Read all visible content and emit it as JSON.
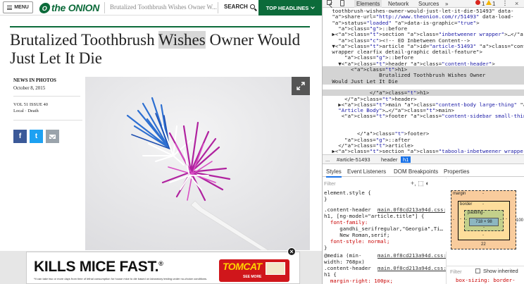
{
  "site": {
    "menu_label": "MENU",
    "logo_mark": "O",
    "logo_text": "the ONION",
    "tab_title": "Brutalized Toothbrush Wishes Owner W...",
    "search_label": "SEARCH",
    "headlines_label": "TOP HEADLINES",
    "headline_before": "Brutalized Toothbrush ",
    "headline_highlight": "Wishes",
    "headline_after": " Owner Would Just Let It Die",
    "kicker": "NEWS IN PHOTOS",
    "date": "October 8, 2015",
    "issue": "VOL 51 ISSUE 40",
    "section": "Local · Death",
    "share_facebook": "f",
    "share_twitter": "t",
    "photo_alt": "toothbrush photo",
    "ad": {
      "headline": "KILLS MICE FAST.",
      "trademark": "®",
      "fine_print": "*It can take two or more days from time of lethal consumption for house mice to die based on laboratory testing under no-choice conditions.",
      "brand": "TOMCAT",
      "cta": "SEE MORE",
      "close": "×"
    }
  },
  "devtools": {
    "tabs": [
      "Elements",
      "Network",
      "Sources",
      "»"
    ],
    "errors": "1",
    "warnings": "1",
    "close": "×",
    "dom_lines": [
      "   toothbrush-wishes-owner-would-just-let-it-die-51493\" data-",
      "   share-url=\"http://www.theonion.com/r/51493\" data-load-",
      "   status=\"loaded\" data-is-graphic=\"true\">",
      "     ::before",
      "   ▶<section class=\"inbetweener wrapper\">…</section>",
      "     <!-- EO Inbetween Content-->",
      "   ▼<article id=\"article-51493\" class=\"content-wrapper",
      "   wrapper clearfix detail-graphic detail-feature\">",
      "       ::before",
      "     ▼<header class=\"content-header\">",
      "         <h1>",
      "                  Brutalized Toothbrush Wishes Owner",
      "   Would Just Let It Die",
      "",
      "               </h1>",
      "       </header>",
      "     ▶<main class=\"content-body large-thing\" data-area=",
      "     \"Article Body\">…</main>",
      "      <footer class=\"content-sidebar small-thing\">",
      "",
      "",
      "           </footer>",
      "       ::after",
      "     </article>",
      "   ▶<section class=\"taboola-inbetweener wrapper\">"
    ],
    "breadcrumbs": [
      "...",
      "#article-51493",
      "header",
      "h1"
    ],
    "panel_tabs": [
      "Styles",
      "Event Listeners",
      "DOM Breakpoints",
      "Properties"
    ],
    "filter_placeholder": "Filter",
    "style_tools": "+, ⬚ ◐",
    "style_lines": [
      "element.style {",
      "}",
      ".content-header",
      "h1, [ng-model=\"article.title\"] {",
      "  font-family:",
      "     gandhi_serifregular,\"Georgia\",Ti…",
      "     New Roman,serif;",
      "  font-style: normal;",
      "}",
      "@media (min-",
      "width: 768px)",
      ".content-header",
      "h1 {",
      "  margin-right: 100px;"
    ],
    "style_source": "main.0f8cd213a94d.css:4",
    "box_model": {
      "margin_label": "margin",
      "border_label": "border",
      "padding_label": "padding",
      "content_size": "718 × 98",
      "margin_top": "-",
      "margin_bottom": "22",
      "margin_left": "-",
      "margin_right": "100",
      "border_top": "-",
      "border_bottom": "-",
      "border_left": "-",
      "border_right": "-",
      "padding_top": "-",
      "padding_bottom": "-",
      "padding_left": "-",
      "padding_right": "-"
    },
    "computed": {
      "filter_placeholder": "Filter",
      "show_inherited": "Show inherited",
      "first_prop": "box-sizing: border-"
    }
  }
}
